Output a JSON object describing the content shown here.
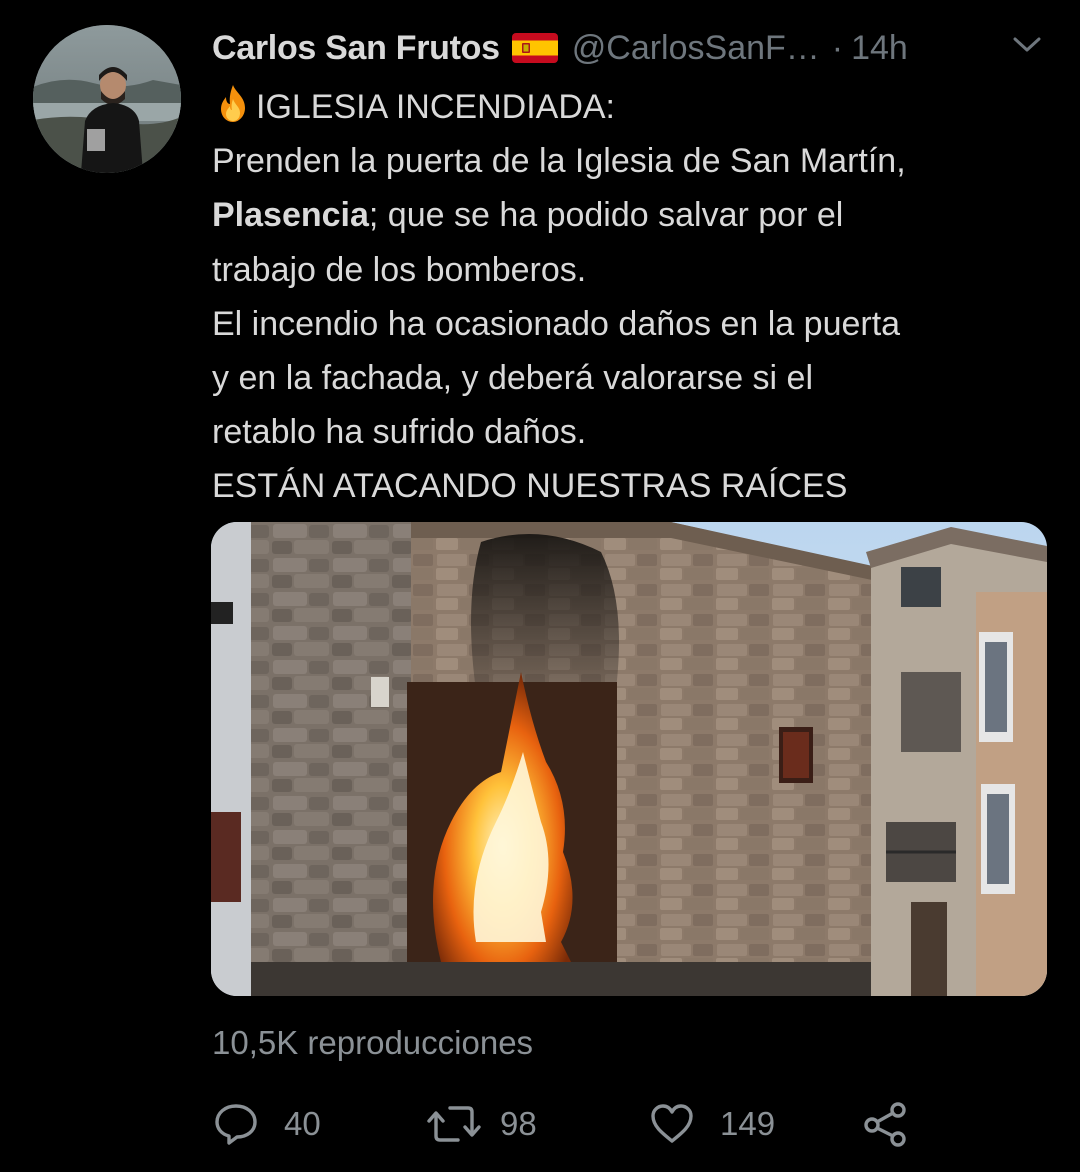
{
  "author": {
    "display_name": "Carlos San Frutos",
    "flag_icon": "spain-flag-icon",
    "handle": "@CarlosSanF…",
    "separator": "·",
    "time": "14h"
  },
  "tweet": {
    "emoji_icon": "fire-emoji-icon",
    "line1": "IGLESIA INCENDIADA:",
    "line2": "Prenden la puerta de la Iglesia de San Martín,",
    "line3_bold": "Plasencia",
    "line3_rest": "; que se ha podido salvar por el",
    "line4": "trabajo de los bomberos.",
    "line5": "El incendio ha ocasionado daños en la puerta",
    "line6": "y en la fachada, y deberá valorarse si el",
    "line7": "retablo ha sufrido daños.",
    "line8": "ESTÁN ATACANDO NUESTRAS RAÍCES"
  },
  "media": {
    "type": "video",
    "views": "10,5K reproducciones"
  },
  "actions": {
    "reply_count": "40",
    "retweet_count": "98",
    "like_count": "149"
  },
  "colors": {
    "background": "#000000",
    "text": "#d9d9d9",
    "secondary": "#6e767d"
  }
}
